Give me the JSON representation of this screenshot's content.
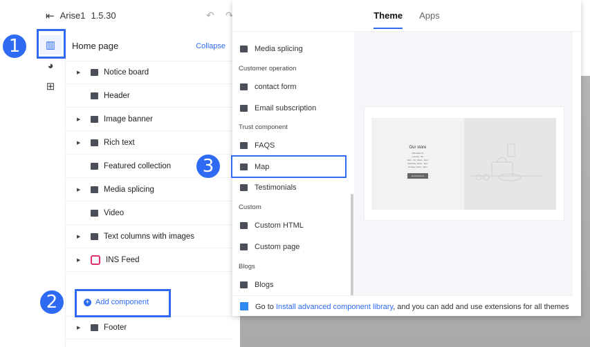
{
  "app": {
    "title": "Arise1",
    "version": "1.5.30"
  },
  "sidebar": {
    "title": "Home page",
    "collapse": "Collapse",
    "items": [
      {
        "label": "Notice board",
        "caret": true
      },
      {
        "label": "Header",
        "caret": false
      },
      {
        "label": "Image banner",
        "caret": true
      },
      {
        "label": "Rich text",
        "caret": true
      },
      {
        "label": "Featured collection",
        "caret": false
      },
      {
        "label": "Media splicing",
        "caret": true
      },
      {
        "label": "Video",
        "caret": false
      },
      {
        "label": "Text columns with images",
        "caret": true
      },
      {
        "label": "INS Feed",
        "caret": true
      }
    ],
    "add_component": "Add component",
    "footer": "Footer"
  },
  "badges": [
    "1",
    "2",
    "3"
  ],
  "popup": {
    "tabs": [
      "Theme",
      "Apps"
    ],
    "groups": [
      "Customer operation",
      "Trust component",
      "Custom",
      "Blogs"
    ],
    "items": [
      "Media splicing",
      "contact form",
      "Email subscription",
      "FAQS",
      "Map",
      "Testimonials",
      "Custom HTML",
      "Custom page",
      "Blogs"
    ],
    "preview": {
      "title": "Our store",
      "lines": [
        "295 Fake St.",
        "London, UK",
        "Mon - Fri, 10am - 9pm",
        "Saturday, 10am - 9pm",
        "Sunday, 10am - 5pm"
      ],
      "button": "Get directions"
    },
    "footer": {
      "prefix": "Go to ",
      "link": "Install advanced component library",
      "suffix": ", and you can add and use extensions for all themes"
    }
  },
  "colors": {
    "accent": "#2f6bf2"
  }
}
